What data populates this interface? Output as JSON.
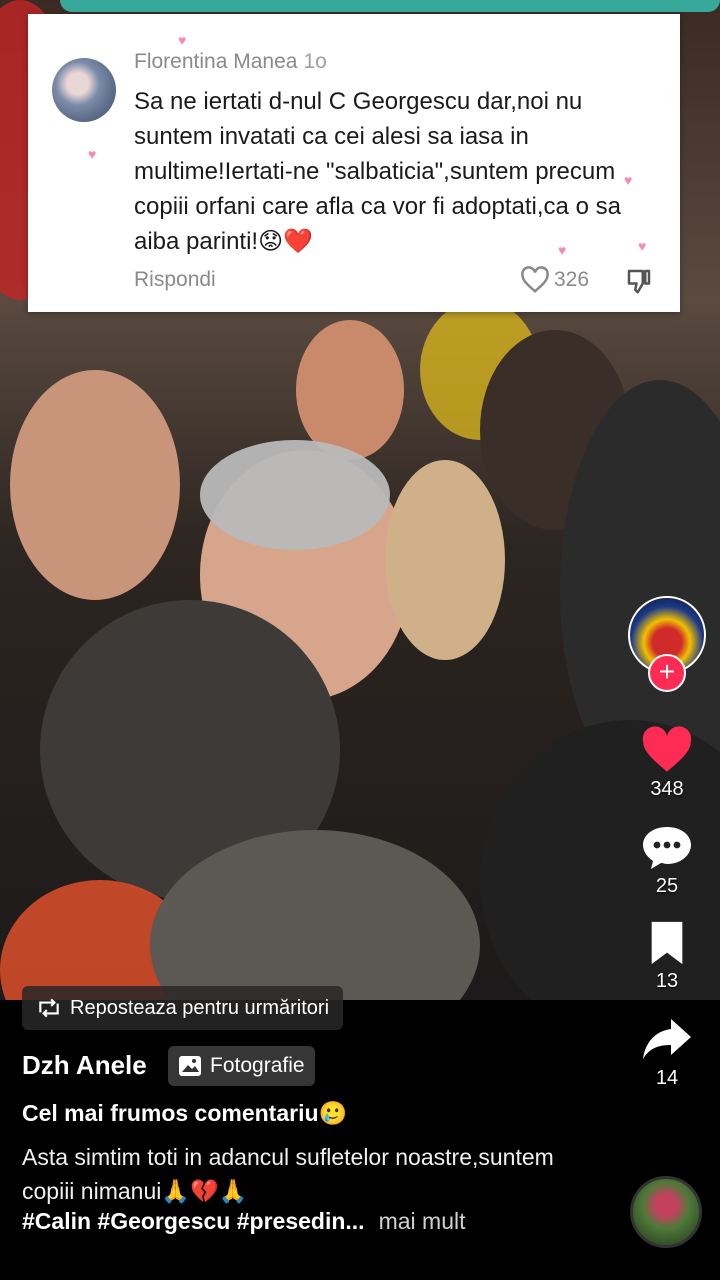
{
  "comment": {
    "author": "Florentina Manea",
    "time": "1o",
    "text": "Sa ne iertati d-nul C Georgescu dar,noi nu suntem invatati ca cei alesi sa iasa in multime!Iertati-ne \"salbaticia\",suntem precum copiii orfani care afla ca vor fi adoptati,ca o sa aiba parinti!😟❤️",
    "reply_label": "Rispondi",
    "likes": "326"
  },
  "actions": {
    "likes": "348",
    "comments": "25",
    "saves": "13",
    "shares": "14"
  },
  "post": {
    "repost_label": "Reposteaza pentru urmăritori",
    "author": "Dzh Anele",
    "tag_label": "Fotografie",
    "title": "Cel mai frumos comentariu🥲",
    "description": "Asta simtim toti in adancul sufletelor noastre,suntem copiii nimanui🙏💔🙏",
    "hashtags": "#Calin #Georgescu #presedin...",
    "more_label": "mai mult"
  },
  "colors": {
    "like_red": "#fe2c55",
    "comment_bar": "#37a99b"
  },
  "icons": [
    "heart-icon",
    "comment-icon",
    "bookmark-icon",
    "share-icon",
    "repost-icon",
    "photo-icon",
    "plus-icon",
    "dislike-icon"
  ]
}
